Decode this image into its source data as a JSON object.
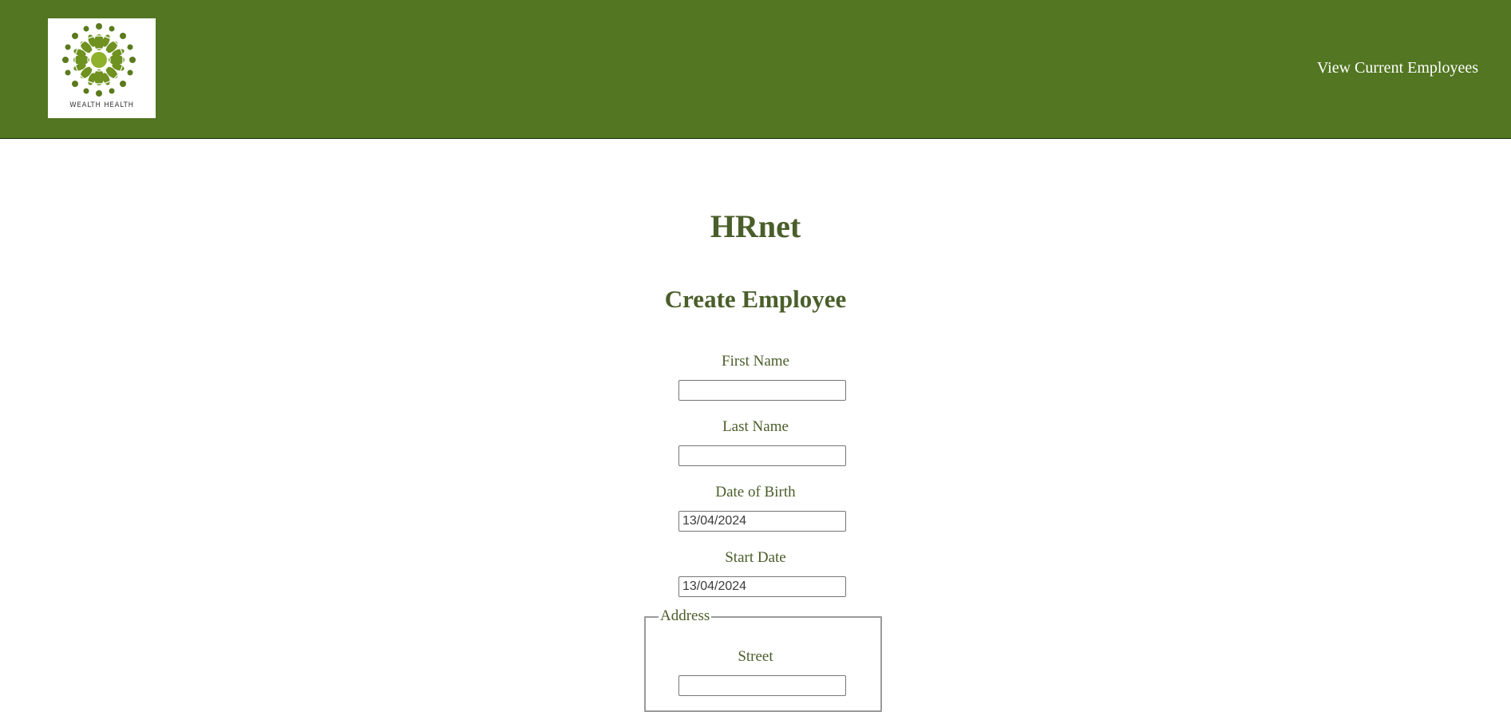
{
  "header": {
    "logo_text": "Wealth Health",
    "nav_link_label": "View Current Employees"
  },
  "main": {
    "title": "HRnet",
    "subtitle": "Create Employee"
  },
  "form": {
    "first_name": {
      "label": "First Name",
      "value": ""
    },
    "last_name": {
      "label": "Last Name",
      "value": ""
    },
    "date_of_birth": {
      "label": "Date of Birth",
      "value": "13/04/2024"
    },
    "start_date": {
      "label": "Start Date",
      "value": "13/04/2024"
    },
    "address": {
      "legend": "Address",
      "street": {
        "label": "Street",
        "value": ""
      }
    }
  },
  "colors": {
    "header_bg": "#527621",
    "text_green": "#4a5e2a",
    "logo_dark_green": "#5b7a1c",
    "logo_light_green": "#8fb02a"
  },
  "icons": {
    "logo": "wealth-health-logo-icon"
  }
}
